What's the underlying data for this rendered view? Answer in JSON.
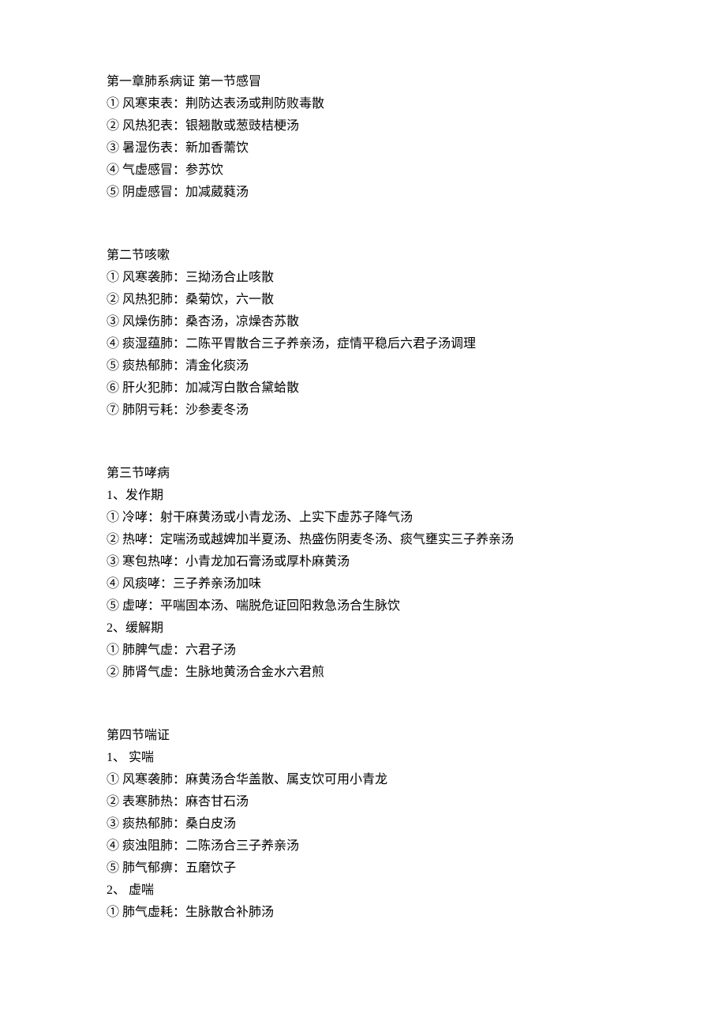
{
  "section1": {
    "heading": "第一章肺系病证 第一节感冒",
    "items": [
      "① 风寒束表：荆防达表汤或荆防败毒散",
      "② 风热犯表：银翘散或葱豉桔梗汤",
      "③ 暑湿伤表：新加香薷饮",
      "④ 气虚感冒：参苏饮",
      "⑤ 阴虚感冒：加减葳蕤汤"
    ]
  },
  "section2": {
    "heading": "第二节咳嗽",
    "items": [
      "① 风寒袭肺：三拗汤合止咳散",
      "② 风热犯肺：桑菊饮，六一散",
      "③ 风燥伤肺：桑杏汤，凉燥杏苏散",
      "④ 痰湿蕴肺：二陈平胃散合三子养亲汤，症情平稳后六君子汤调理",
      "⑤ 痰热郁肺：清金化痰汤",
      "⑥ 肝火犯肺：加减泻白散合黛蛤散",
      "⑦ 肺阴亏耗：沙参麦冬汤"
    ]
  },
  "section3": {
    "heading": "第三节哮病",
    "sub1_label": "1、发作期",
    "sub1_items": [
      "① 冷哮：射干麻黄汤或小青龙汤、上实下虚苏子降气汤",
      "② 热哮：定喘汤或越婢加半夏汤、热盛伤阴麦冬汤、痰气壅实三子养亲汤",
      "③ 寒包热哮：小青龙加石膏汤或厚朴麻黄汤",
      "④ 风痰哮：三子养亲汤加味",
      "⑤ 虚哮：平喘固本汤、喘脱危证回阳救急汤合生脉饮"
    ],
    "sub2_label": "2、缓解期",
    "sub2_items": [
      "① 肺脾气虚：六君子汤",
      "② 肺肾气虚：生脉地黄汤合金水六君煎"
    ]
  },
  "section4": {
    "heading": "第四节喘证",
    "sub1_label": "1、 实喘",
    "sub1_items": [
      "① 风寒袭肺：麻黄汤合华盖散、属支饮可用小青龙",
      "② 表寒肺热：麻杏甘石汤",
      "③ 痰热郁肺：桑白皮汤",
      "④ 痰浊阻肺：二陈汤合三子养亲汤",
      "⑤ 肺气郁痹：五磨饮子"
    ],
    "sub2_label": "2、 虚喘",
    "sub2_items": [
      "①  肺气虚耗：生脉散合补肺汤"
    ]
  }
}
